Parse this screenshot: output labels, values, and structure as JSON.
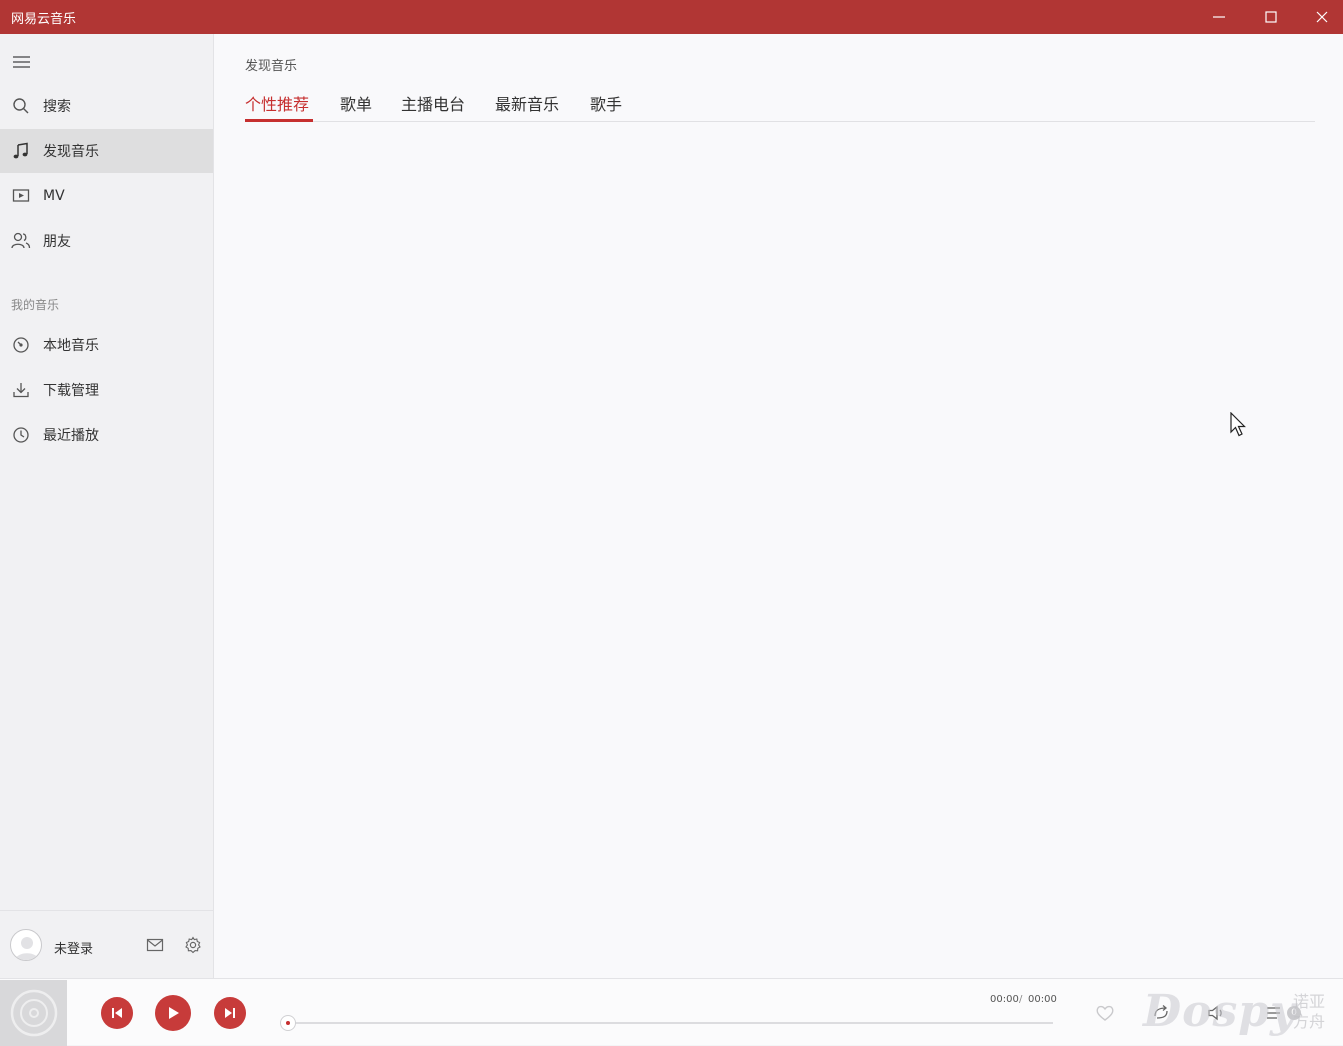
{
  "window": {
    "title": "网易云音乐"
  },
  "sidebar": {
    "items": [
      {
        "label": "搜索",
        "icon": "search-icon"
      },
      {
        "label": "发现音乐",
        "icon": "music-note-icon",
        "active": true
      },
      {
        "label": "MV",
        "icon": "video-icon"
      },
      {
        "label": "朋友",
        "icon": "friends-icon"
      }
    ],
    "section_title": "我的音乐",
    "my_music": [
      {
        "label": "本地音乐",
        "icon": "local-music-icon"
      },
      {
        "label": "下载管理",
        "icon": "download-icon"
      },
      {
        "label": "最近播放",
        "icon": "clock-icon"
      }
    ],
    "user": {
      "name": "未登录"
    }
  },
  "main": {
    "breadcrumb": "发现音乐",
    "tabs": [
      {
        "label": "个性推荐",
        "active": true
      },
      {
        "label": "歌单"
      },
      {
        "label": "主播电台"
      },
      {
        "label": "最新音乐"
      },
      {
        "label": "歌手"
      }
    ]
  },
  "player": {
    "current_time": "00:00",
    "separator": "/",
    "total_time": "00:00",
    "progress": 0,
    "playlist_count": "0"
  },
  "watermark": {
    "brand": "Dospy",
    "line1": "诺亚",
    "line2": "方舟"
  },
  "colors": {
    "accent": "#c62f2f",
    "titlebar": "#b13634",
    "control": "#c73b3a"
  }
}
